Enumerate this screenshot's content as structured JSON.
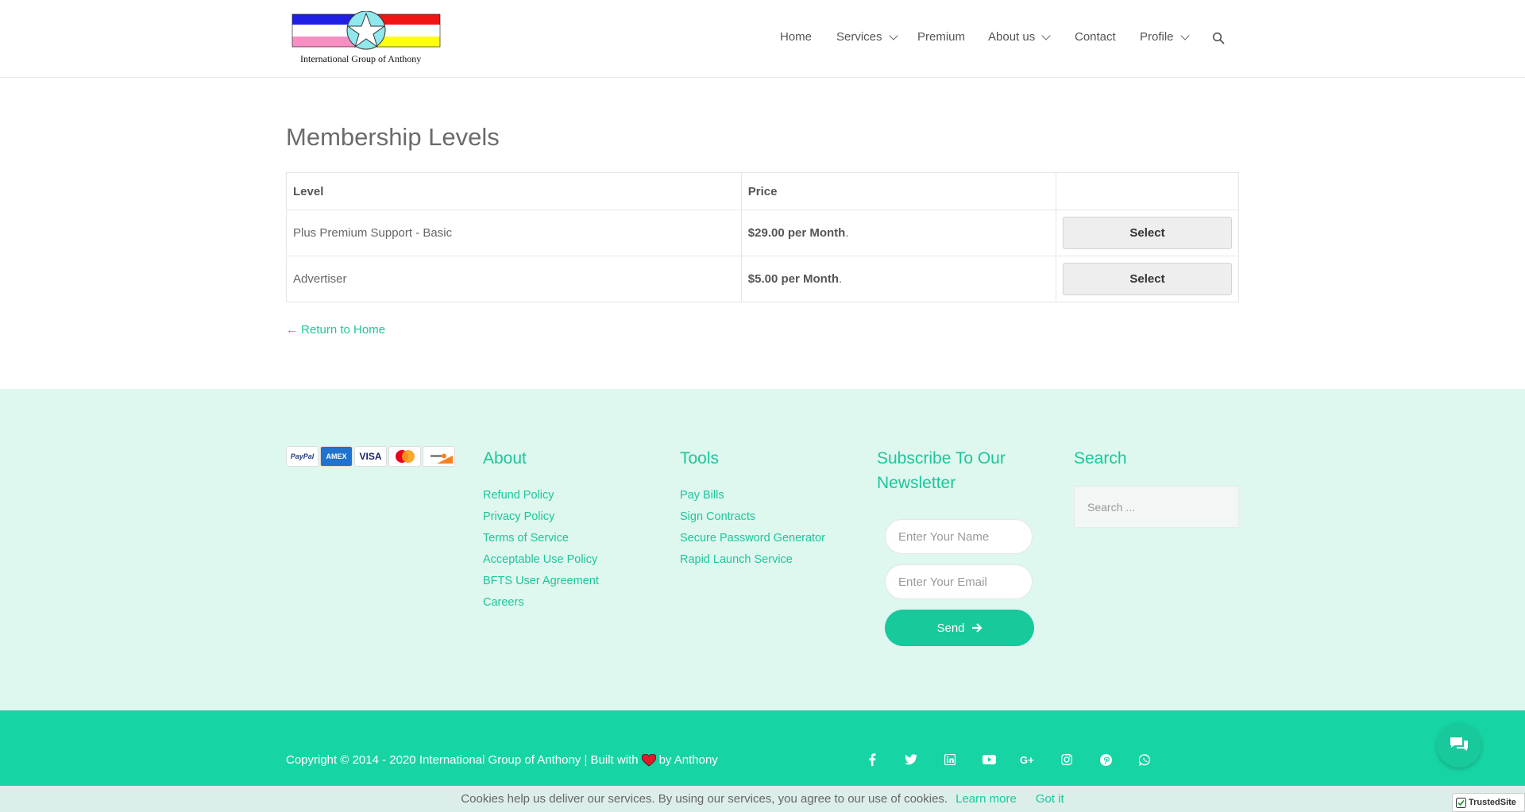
{
  "brand": {
    "caption": "International Group of Anthony",
    "colors": {
      "blue": "#1f1fe6",
      "red": "#f01414",
      "pink": "#f78fc4",
      "yellow": "#ffff10",
      "star": "#8ee8ec"
    }
  },
  "nav": {
    "items": [
      {
        "label": "Home",
        "dropdown": false
      },
      {
        "label": "Services",
        "dropdown": true
      },
      {
        "label": "Premium",
        "dropdown": false
      },
      {
        "label": "About us",
        "dropdown": true
      },
      {
        "label": "Contact",
        "dropdown": false
      },
      {
        "label": "Profile",
        "dropdown": true
      }
    ],
    "search_icon": "search-icon"
  },
  "main": {
    "title": "Membership Levels",
    "table": {
      "headers": [
        "Level",
        "Price",
        ""
      ],
      "rows": [
        {
          "level": "Plus Premium Support - Basic",
          "price": "$29.00 per Month",
          "suffix": ".",
          "button": "Select"
        },
        {
          "level": "Advertiser",
          "price": "$5.00 per Month",
          "suffix": ".",
          "button": "Select"
        }
      ]
    },
    "return_link": "← Return to Home"
  },
  "footer": {
    "payment_cards": [
      "PayPal",
      "AMEX",
      "VISA",
      "mastercard",
      "discover"
    ],
    "about": {
      "title": "About",
      "links": [
        "Refund Policy",
        "Privacy Policy",
        "Terms of Service",
        "Acceptable Use Policy",
        "BFTS User Agreement",
        "Careers"
      ]
    },
    "tools": {
      "title": "Tools",
      "links": [
        "Pay Bills",
        "Sign Contracts",
        "Secure Password Generator",
        "Rapid Launch Service"
      ]
    },
    "newsletter": {
      "title_line1": "Subscribe To Our",
      "title_line2": "Newsletter",
      "name_placeholder": "Enter Your Name",
      "email_placeholder": "Enter Your Email",
      "send_label": "Send"
    },
    "search": {
      "title": "Search",
      "placeholder": "Search ..."
    }
  },
  "bottom": {
    "copyright_before": "Copyright © 2014 - 2020 International Group of Anthony | Built with",
    "copyright_after": "by Anthony",
    "social_icons": [
      "facebook-icon",
      "twitter-icon",
      "linkedin-icon",
      "youtube-icon",
      "google-plus-icon",
      "instagram-icon",
      "pinterest-icon",
      "whatsapp-icon"
    ],
    "accent": "#17d4a5"
  },
  "cookie": {
    "message": "Cookies help us deliver our services. By using our services, you agree to our use of cookies.",
    "learn_more": "Learn more",
    "got_it": "Got it"
  },
  "badge": {
    "trusted": "TrustedSite"
  }
}
